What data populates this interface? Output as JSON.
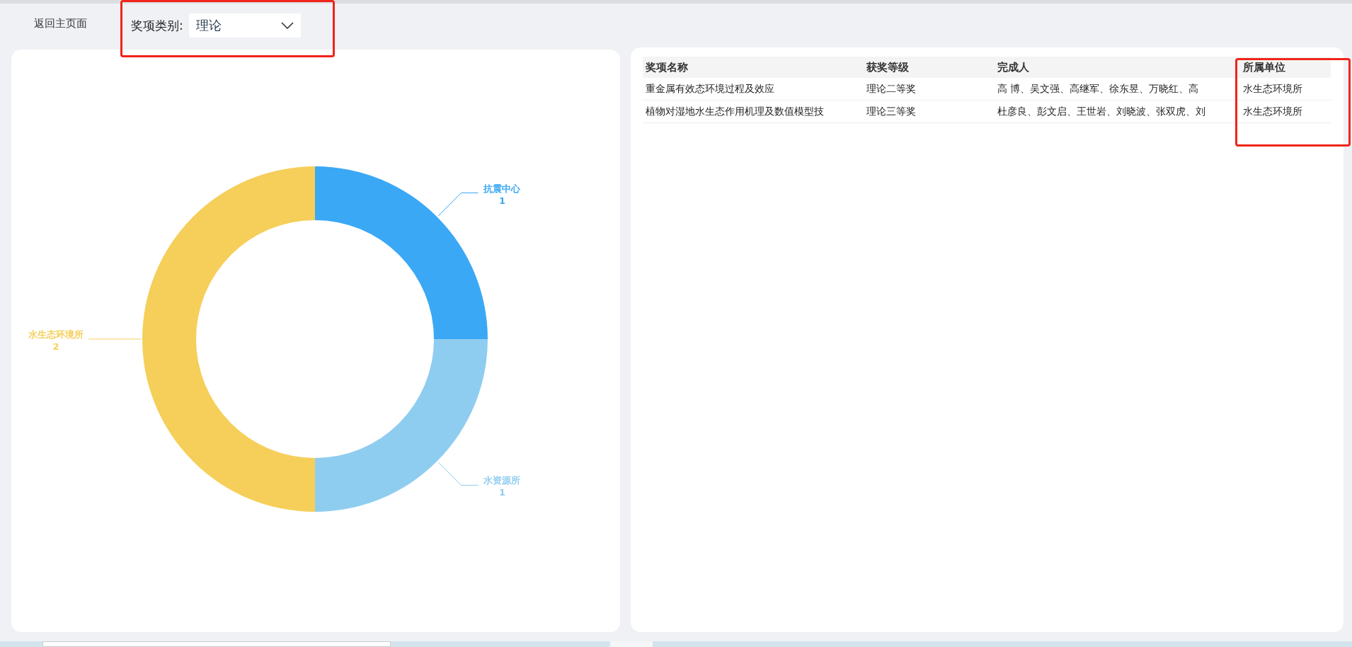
{
  "toolbar": {
    "back_link": "返回主页面",
    "filter": {
      "label": "奖项类别:",
      "value": "理论"
    }
  },
  "chart": {
    "chart_data": {
      "type": "donut",
      "categories": [
        "抗震中心",
        "水资源所",
        "水生态环境所"
      ],
      "values": [
        1,
        1,
        2
      ],
      "data_labels": true,
      "colors": [
        "#3aa8f5",
        "#8fcdf0",
        "#f5cf5a"
      ]
    }
  },
  "table": {
    "columns": [
      "奖项名称",
      "获奖等级",
      "完成人",
      "所属单位"
    ],
    "rows": [
      [
        "重金属有效态环境过程及效应",
        "理论二等奖",
        "高  博、吴文强、高继军、徐东昱、万晓红、高",
        "水生态环境所"
      ],
      [
        "植物对湿地水生态作用机理及数值模型技",
        "理论三等奖",
        "杜彦良、彭文启、王世岩、刘晓波、张双虎、刘",
        "水生态环境所"
      ]
    ]
  }
}
